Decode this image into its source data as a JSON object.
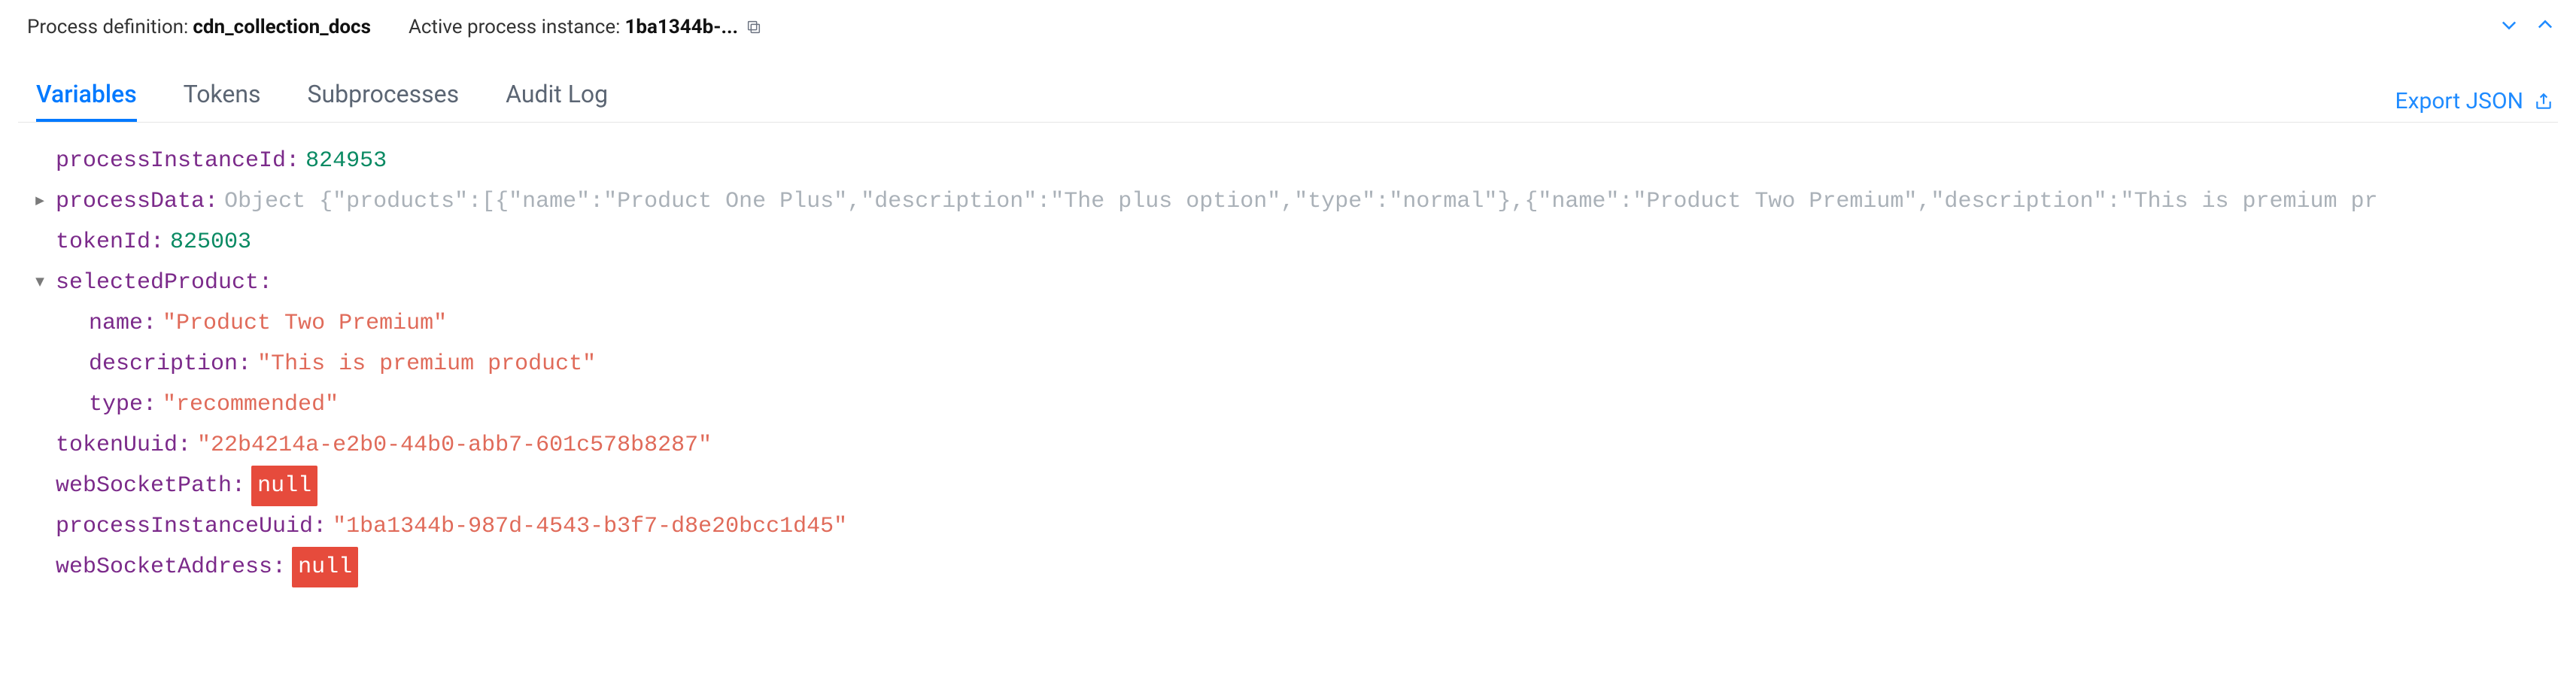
{
  "header": {
    "proc_def_label": "Process definition:",
    "proc_def_value": "cdn_collection_docs",
    "active_instance_label": "Active process instance:",
    "active_instance_value": "1ba1344b-..."
  },
  "tabs": {
    "t0": "Variables",
    "t1": "Tokens",
    "t2": "Subprocesses",
    "t3": "Audit Log",
    "export_label": "Export JSON"
  },
  "vars": {
    "processInstanceId": {
      "key": "processInstanceId",
      "value": "824953"
    },
    "processData": {
      "key": "processData",
      "preview": "Object {\"products\":[{\"name\":\"Product One Plus\",\"description\":\"The plus option\",\"type\":\"normal\"},{\"name\":\"Product Two Premium\",\"description\":\"This is premium pr"
    },
    "tokenId": {
      "key": "tokenId",
      "value": "825003"
    },
    "selectedProduct": {
      "key": "selectedProduct",
      "name_key": "name",
      "name_val": "\"Product Two Premium\"",
      "desc_key": "description",
      "desc_val": "\"This is premium product\"",
      "type_key": "type",
      "type_val": "\"recommended\""
    },
    "tokenUuid": {
      "key": "tokenUuid",
      "value": "\"22b4214a-e2b0-44b0-abb7-601c578b8287\""
    },
    "webSocketPath": {
      "key": "webSocketPath",
      "value": "null"
    },
    "processInstanceUuid": {
      "key": "processInstanceUuid",
      "value": "\"1ba1344b-987d-4543-b3f7-d8e20bcc1d45\""
    },
    "webSocketAddress": {
      "key": "webSocketAddress",
      "value": "null"
    }
  }
}
